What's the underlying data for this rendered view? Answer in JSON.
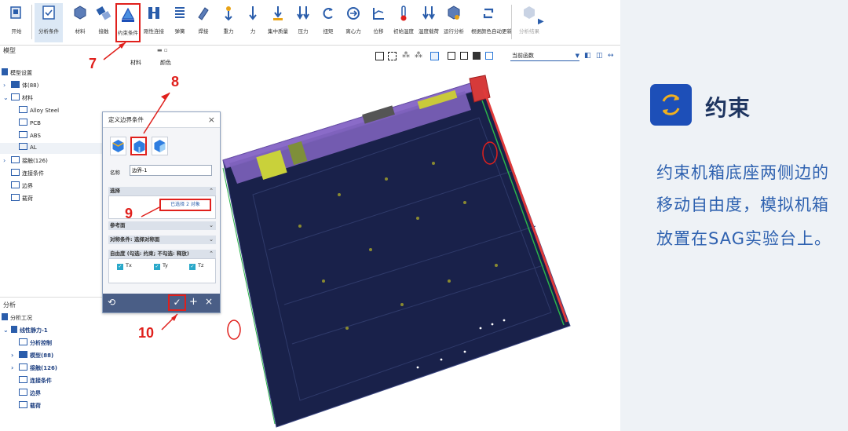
{
  "toolbar": {
    "items": [
      {
        "label": "开始",
        "icon": "start-icon"
      },
      {
        "label": "分析条件",
        "icon": "analysis-condition-icon"
      },
      {
        "label": "材料",
        "icon": "material-icon"
      },
      {
        "label": "接触",
        "icon": "contact-icon"
      },
      {
        "label": "约束条件",
        "icon": "constraint-icon"
      },
      {
        "label": "刚性连接",
        "icon": "rigid-link-icon"
      },
      {
        "label": "弹簧",
        "icon": "spring-icon"
      },
      {
        "label": "焊接",
        "icon": "weld-icon"
      },
      {
        "label": "重力",
        "icon": "gravity-icon"
      },
      {
        "label": "力",
        "icon": "force-icon"
      },
      {
        "label": "集中质量",
        "icon": "lumped-mass-icon"
      },
      {
        "label": "压力",
        "icon": "pressure-icon"
      },
      {
        "label": "扭矩",
        "icon": "torque-icon"
      },
      {
        "label": "离心力",
        "icon": "centrifugal-icon"
      },
      {
        "label": "位移",
        "icon": "displacement-icon"
      },
      {
        "label": "初始温度",
        "icon": "initial-temp-icon"
      },
      {
        "label": "温度载荷",
        "icon": "temp-load-icon"
      },
      {
        "label": "运行分析",
        "icon": "run-analysis-icon"
      },
      {
        "label": "根据颜色自动更新",
        "icon": "color-update-icon"
      },
      {
        "label": "分析结果",
        "icon": "analysis-result-icon"
      }
    ]
  },
  "left": {
    "model_header": "模型",
    "columns": {
      "material": "材料",
      "color": "颜色"
    },
    "model_tree": [
      {
        "label": "模型设置"
      },
      {
        "label": "体(88)"
      },
      {
        "label": "材料"
      },
      {
        "label": "Alloy Steel"
      },
      {
        "label": "PCB"
      },
      {
        "label": "ABS"
      },
      {
        "label": "AL"
      },
      {
        "label": "接触(126)"
      },
      {
        "label": "连接条件"
      },
      {
        "label": "边界"
      },
      {
        "label": "载荷"
      }
    ],
    "analysis_header": "分析",
    "analysis_tree": [
      {
        "label": "分析工况"
      },
      {
        "label": "线性静力-1"
      },
      {
        "label": "分析控制"
      },
      {
        "label": "模型(88)"
      },
      {
        "label": "接触(126)"
      },
      {
        "label": "连接条件"
      },
      {
        "label": "边界"
      },
      {
        "label": "载荷"
      }
    ]
  },
  "view": {
    "function_select": "当前函数"
  },
  "dialog": {
    "title": "定义边界条件",
    "name_label": "名称",
    "name_value": "边界-1",
    "select_section": "选择",
    "selected_value": "已选择 2 对象",
    "ref_section": "参考面",
    "symmetry_section": "对称条件: 选择对称面",
    "dof_section": "自由度 (勾选: 约束; 不勾选: 释放)",
    "dof": [
      {
        "label": "Tx",
        "checked": true
      },
      {
        "label": "Ty",
        "checked": true
      },
      {
        "label": "Tz",
        "checked": true
      }
    ]
  },
  "annotations": [
    "7",
    "8",
    "9",
    "10"
  ],
  "info": {
    "title": "约束",
    "lines": [
      "约束机箱底座两侧边的",
      "移动自由度，模拟机箱",
      "放置在SAG实验台上。"
    ],
    "icon": "constraint-cycle-icon"
  },
  "colors": {
    "accent": "#1d4fb8",
    "annotation": "#e0201c",
    "dialog_footer": "#4a5e86",
    "check": "#29a8c9",
    "info_text": "#2f62b0"
  }
}
